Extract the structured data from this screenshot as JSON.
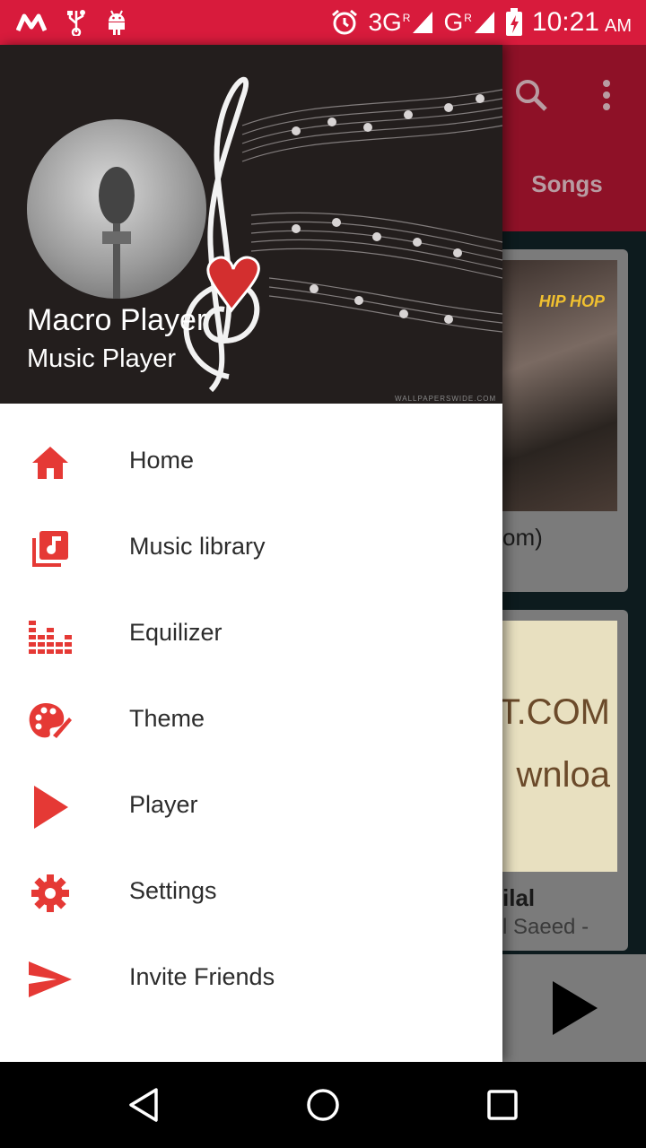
{
  "status_bar": {
    "time": "10:21",
    "ampm": "AM",
    "network1": "3G",
    "network1_sup": "R",
    "network2": "G",
    "network2_sup": "R",
    "icons": [
      "m-logo-icon",
      "usb-icon",
      "android-icon",
      "alarm-icon",
      "signal-icon",
      "battery-charging-icon"
    ]
  },
  "app": {
    "tab_label": "Songs",
    "card1": {
      "title_partial": "om)",
      "art_text": "HIP HOP"
    },
    "card2": {
      "title_partial": "ilal",
      "subtitle_partial": "l Saeed -",
      "art_text_1": "T.COM",
      "art_text_2": "wnloa"
    }
  },
  "drawer": {
    "title": "Macro Player",
    "subtitle": "Music Player",
    "watermark": "WALLPAPERSWIDE.COM",
    "items": [
      {
        "label": "Home",
        "icon": "home-icon"
      },
      {
        "label": "Music library",
        "icon": "music-library-icon"
      },
      {
        "label": "Equilizer",
        "icon": "equalizer-icon"
      },
      {
        "label": "Theme",
        "icon": "palette-icon"
      },
      {
        "label": "Player",
        "icon": "play-icon"
      },
      {
        "label": "Settings",
        "icon": "gear-icon"
      },
      {
        "label": "Invite Friends",
        "icon": "send-icon"
      }
    ]
  },
  "colors": {
    "status_bar": "#d81b3c",
    "accent": "#e53935",
    "drawer_header": "#231e1d"
  }
}
